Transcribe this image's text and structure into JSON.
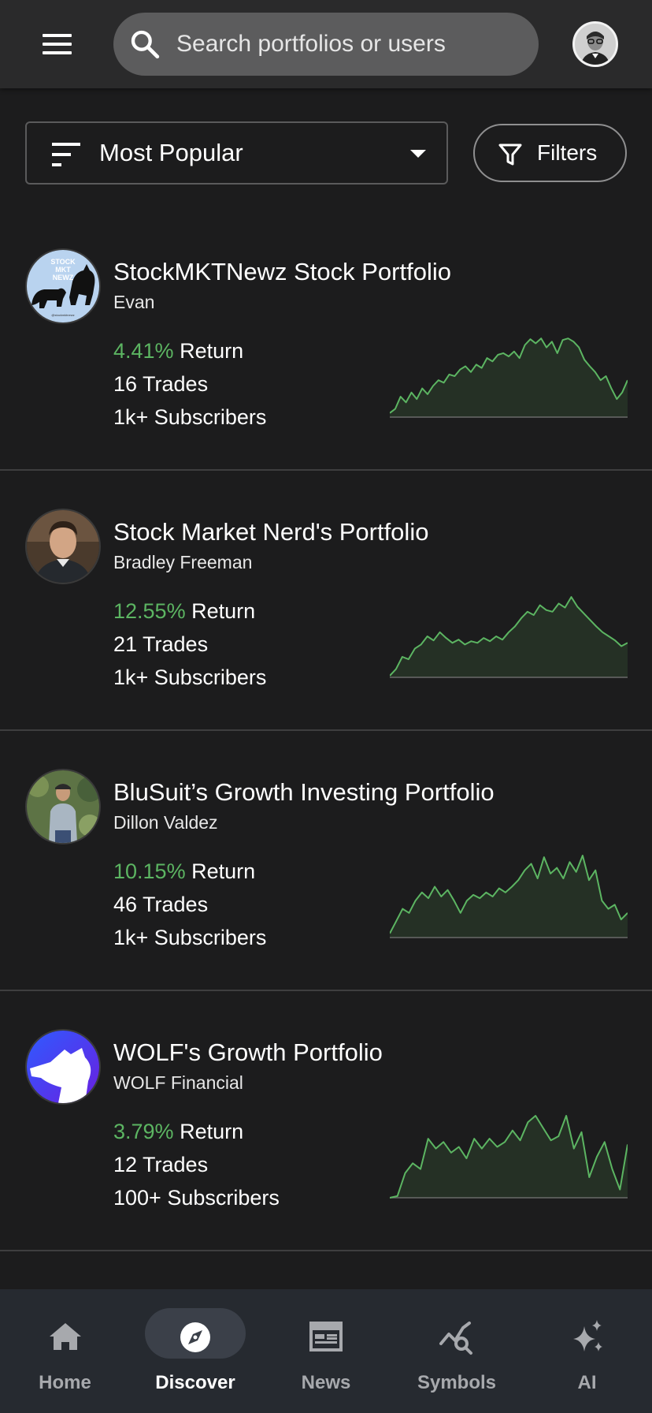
{
  "header": {
    "search_placeholder": "Search portfolios or users"
  },
  "sort": {
    "selected": "Most Popular"
  },
  "filters_label": "Filters",
  "portfolios": [
    {
      "title": "StockMKTNewz Stock Portfolio",
      "owner": "Evan",
      "return_pct": "4.41%",
      "return_label": " Return",
      "trades": "16 Trades",
      "subscribers": "1k+ Subscribers",
      "avatar_text": "STOCK MKT NEWZ",
      "sparkline": [
        0.05,
        0.1,
        0.25,
        0.18,
        0.3,
        0.22,
        0.35,
        0.28,
        0.38,
        0.45,
        0.42,
        0.52,
        0.5,
        0.58,
        0.62,
        0.55,
        0.64,
        0.6,
        0.72,
        0.68,
        0.76,
        0.78,
        0.74,
        0.8,
        0.72,
        0.88,
        0.95,
        0.9,
        0.96,
        0.85,
        0.92,
        0.78,
        0.94,
        0.96,
        0.92,
        0.85,
        0.7,
        0.62,
        0.55,
        0.45,
        0.5,
        0.35,
        0.22,
        0.3,
        0.45
      ]
    },
    {
      "title": "Stock Market Nerd's Portfolio",
      "owner": "Bradley Freeman",
      "return_pct": "12.55%",
      "return_label": " Return",
      "trades": "21 Trades",
      "subscribers": "1k+ Subscribers",
      "sparkline": [
        0.02,
        0.1,
        0.25,
        0.22,
        0.35,
        0.4,
        0.5,
        0.45,
        0.55,
        0.48,
        0.42,
        0.46,
        0.4,
        0.44,
        0.42,
        0.48,
        0.44,
        0.5,
        0.46,
        0.55,
        0.62,
        0.72,
        0.8,
        0.76,
        0.88,
        0.82,
        0.8,
        0.9,
        0.85,
        0.98,
        0.86,
        0.78,
        0.7,
        0.62,
        0.55,
        0.5,
        0.45,
        0.38,
        0.42
      ]
    },
    {
      "title": "BluSuit’s Growth Investing Portfolio",
      "owner": "Dillon Valdez",
      "return_pct": "10.15%",
      "return_label": " Return",
      "trades": "46 Trades",
      "subscribers": "1k+ Subscribers",
      "sparkline": [
        0.05,
        0.2,
        0.35,
        0.3,
        0.45,
        0.55,
        0.48,
        0.62,
        0.5,
        0.58,
        0.45,
        0.3,
        0.45,
        0.52,
        0.48,
        0.55,
        0.5,
        0.6,
        0.55,
        0.62,
        0.7,
        0.82,
        0.9,
        0.72,
        0.98,
        0.78,
        0.85,
        0.72,
        0.92,
        0.8,
        1.0,
        0.7,
        0.82,
        0.45,
        0.35,
        0.4,
        0.22,
        0.3
      ]
    },
    {
      "title": "WOLF's Growth Portfolio",
      "owner": "WOLF Financial",
      "return_pct": "3.79%",
      "return_label": " Return",
      "trades": "12 Trades",
      "subscribers": "100+ Subscribers",
      "sparkline": [
        0.0,
        0.02,
        0.3,
        0.42,
        0.35,
        0.72,
        0.6,
        0.68,
        0.55,
        0.62,
        0.48,
        0.72,
        0.6,
        0.72,
        0.62,
        0.68,
        0.82,
        0.7,
        0.92,
        1.0,
        0.85,
        0.7,
        0.75,
        1.0,
        0.6,
        0.8,
        0.25,
        0.5,
        0.68,
        0.35,
        0.1,
        0.65
      ]
    }
  ],
  "nav": [
    {
      "label": "Home",
      "icon": "home-icon"
    },
    {
      "label": "Discover",
      "icon": "compass-icon",
      "active": true
    },
    {
      "label": "News",
      "icon": "newspaper-icon"
    },
    {
      "label": "Symbols",
      "icon": "chart-search-icon"
    },
    {
      "label": "AI",
      "icon": "sparkle-icon"
    }
  ],
  "colors": {
    "positive": "#5cb562",
    "background": "#1c1c1d",
    "topbar": "#2a2a2b",
    "nav": "#262a30"
  }
}
